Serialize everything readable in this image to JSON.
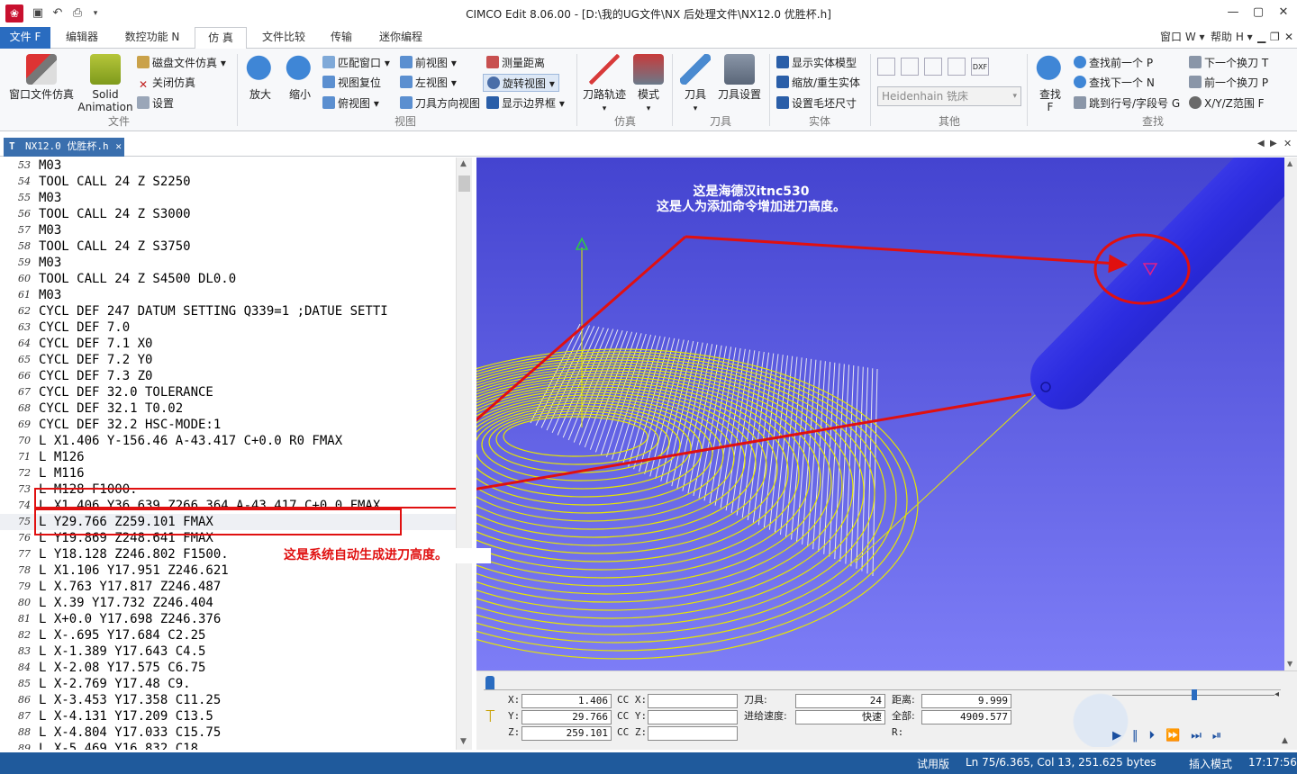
{
  "window": {
    "title": "CIMCO Edit 8.06.00 - [D:\\我的UG文件\\NX 后处理文件\\NX12.0 优胜杯.h]",
    "min": "—",
    "restore": "▢",
    "close": "✕",
    "sub_min": "▁",
    "sub_restore": "❐",
    "sub_close": "✕"
  },
  "ribbon_tabs": [
    "文件 F",
    "编辑器",
    "数控功能 N",
    "仿 真",
    "文件比较",
    "传输",
    "迷你编程"
  ],
  "ribbon_right": {
    "window": "窗口 W",
    "help": "帮助 H"
  },
  "groups": {
    "file": {
      "label": "文件",
      "window_sim": "窗口文件仿真",
      "solid": "Solid Animation",
      "disk_sim": "磁盘文件仿真",
      "close_sim": "关闭仿真",
      "settings": "设置"
    },
    "view": {
      "label": "视图",
      "zoom_in": "放大",
      "zoom_out": "缩小",
      "fit": "匹配窗口",
      "reset": "视图复位",
      "top": "俯视图",
      "front": "前视图",
      "left": "左视图",
      "tool_dir": "刀具方向视图",
      "measure": "测量距离",
      "rotate": "旋转视图",
      "bounds": "显示边界框"
    },
    "sim": {
      "label": "仿真",
      "toolpath": "刀路轨迹",
      "mode": "模式"
    },
    "tool": {
      "label": "刀具",
      "tool": "刀具",
      "tool_setup": "刀具设置"
    },
    "solid": {
      "label": "实体",
      "show_solid": "显示实体模型",
      "zoom_regen": "缩放/重生实体",
      "stock": "设置毛坯尺寸"
    },
    "other": {
      "label": "其他",
      "machine": "Heidenhain 铣床"
    },
    "find": {
      "label": "查找",
      "find": "查找",
      "find_key": "F",
      "prev": "查找前一个 P",
      "next": "查找下一个 N",
      "goto": "跳到行号/字段号 G",
      "next_tool": "下一个换刀 T",
      "prev_tool": "前一个换刀 P",
      "xyz": "X/Y/Z范围 F"
    }
  },
  "doc_tab": "NX12.0 优胜杯.h",
  "editor": {
    "lines": [
      {
        "n": "53",
        "t": "M03"
      },
      {
        "n": "54",
        "t": "TOOL CALL 24 Z S2250"
      },
      {
        "n": "55",
        "t": "M03"
      },
      {
        "n": "56",
        "t": "TOOL CALL 24 Z S3000"
      },
      {
        "n": "57",
        "t": "M03"
      },
      {
        "n": "58",
        "t": "TOOL CALL 24 Z S3750"
      },
      {
        "n": "59",
        "t": "M03"
      },
      {
        "n": "60",
        "t": "TOOL CALL 24 Z S4500 DL0.0"
      },
      {
        "n": "61",
        "t": "M03"
      },
      {
        "n": "62",
        "t": "CYCL DEF 247 DATUM SETTING Q339=1 ;DATUE SETTI"
      },
      {
        "n": "63",
        "t": "CYCL DEF 7.0"
      },
      {
        "n": "64",
        "t": "CYCL DEF 7.1 X0"
      },
      {
        "n": "65",
        "t": "CYCL DEF 7.2 Y0"
      },
      {
        "n": "66",
        "t": "CYCL DEF 7.3 Z0"
      },
      {
        "n": "67",
        "t": "CYCL DEF 32.0 TOLERANCE"
      },
      {
        "n": "68",
        "t": "CYCL DEF 32.1 T0.02"
      },
      {
        "n": "69",
        "t": "CYCL DEF 32.2 HSC-MODE:1"
      },
      {
        "n": "70",
        "t": "L X1.406 Y-156.46 A-43.417 C+0.0 R0 FMAX"
      },
      {
        "n": "71",
        "t": "L M126"
      },
      {
        "n": "72",
        "t": "L M116"
      },
      {
        "n": "73",
        "t": "L M128 F1000."
      },
      {
        "n": "74",
        "t": "L X1.406 Y36.639 Z266.364 A-43.417 C+0.0 FMAX"
      },
      {
        "n": "75",
        "t": "L Y29.766 Z259.101 FMAX"
      },
      {
        "n": "76",
        "t": "L Y19.869 Z248.641 FMAX"
      },
      {
        "n": "77",
        "t": "L Y18.128 Z246.802 F1500."
      },
      {
        "n": "78",
        "t": "L X1.106 Y17.951 Z246.621"
      },
      {
        "n": "79",
        "t": "L X.763 Y17.817 Z246.487"
      },
      {
        "n": "80",
        "t": "L X.39 Y17.732 Z246.404"
      },
      {
        "n": "81",
        "t": "L X+0.0 Y17.698 Z246.376"
      },
      {
        "n": "82",
        "t": "L X-.695 Y17.684 C2.25"
      },
      {
        "n": "83",
        "t": "L X-1.389 Y17.643 C4.5"
      },
      {
        "n": "84",
        "t": "L X-2.08 Y17.575 C6.75"
      },
      {
        "n": "85",
        "t": "L X-2.769 Y17.48 C9."
      },
      {
        "n": "86",
        "t": "L X-3.453 Y17.358 C11.25"
      },
      {
        "n": "87",
        "t": "L X-4.131 Y17.209 C13.5"
      },
      {
        "n": "88",
        "t": "L X-4.804 Y17.033 C15.75"
      },
      {
        "n": "89",
        "t": "L X-5.469 Y16.832 C18."
      }
    ]
  },
  "annotations": {
    "a1_line1": "这是海德汉itnc530",
    "a1_line2": "这是人为添加命令增加进刀高度。",
    "a2": "这是系统自动生成进刀高度。"
  },
  "sim_panel": {
    "x_label": "X:",
    "x": "1.406",
    "y_label": "Y:",
    "y": "29.766",
    "z_label": "Z:",
    "z": "259.101",
    "ccx_label": "CC X:",
    "ccx": "",
    "ccy_label": "CC Y:",
    "ccy": "",
    "ccz_label": "CC Z:",
    "ccz": "",
    "tool_label": "刀具:",
    "tool": "24",
    "feed_label": "进给速度:",
    "feed": "快速",
    "dist_label": "距离:",
    "dist": "9.999",
    "total_label": "全部:",
    "total": "4909.577",
    "r_label": "R:",
    "r": ""
  },
  "status": {
    "trial": "试用版",
    "pos": "Ln 75/6.365, Col 13, 251.625 bytes",
    "mode": "插入模式",
    "time": "17:17:56"
  },
  "colors": {
    "accent": "#2a6cc0",
    "status_bar": "#1f5a9c",
    "viewport_top": "#4444d0",
    "viewport_bottom": "#7d7df6",
    "tool": "#3a3ae0",
    "toolpath": "#e6e600",
    "annotation": "#e01010"
  }
}
